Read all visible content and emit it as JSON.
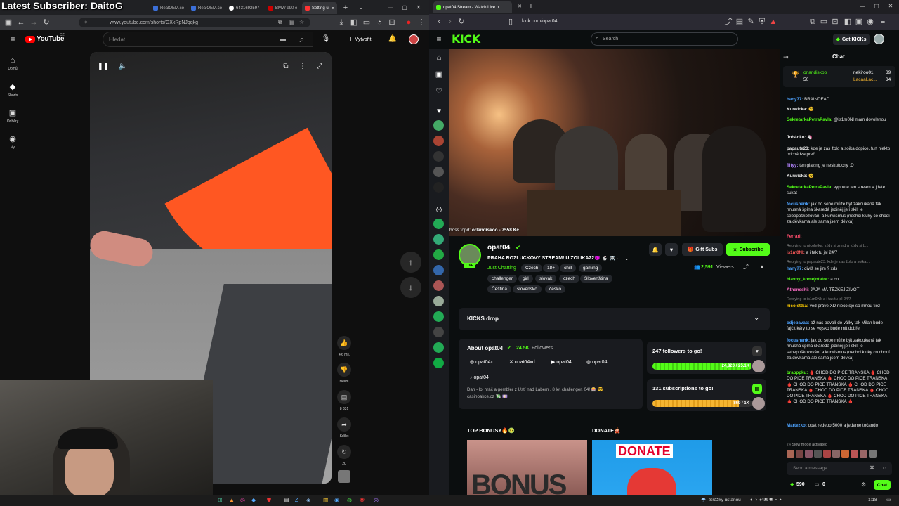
{
  "overlay": {
    "latest_subscriber": "Latest Subscriber: DaitoG"
  },
  "left_browser": {
    "tabs": [
      {
        "label": "RealOEM.co"
      },
      {
        "label": "RealOEM.co"
      },
      {
        "label": "6431692597"
      },
      {
        "label": "BMW e90 e"
      },
      {
        "label": "Setting u"
      }
    ],
    "url": "www.youtube.com/shorts/GXkRpNJqqkg"
  },
  "youtube": {
    "logo": "YouTube",
    "logo_region": "CZ",
    "search_placeholder": "Hledat",
    "create_label": "Vytvořit",
    "nav": [
      {
        "label": "Domů",
        "icon": "home-icon"
      },
      {
        "label": "Shorts",
        "icon": "shorts-icon"
      },
      {
        "label": "Odběry",
        "icon": "subscriptions-icon"
      },
      {
        "label": "Vy",
        "icon": "you-icon"
      }
    ],
    "actions": {
      "likes": "4,6 mil.",
      "dislike": "Nelíbí",
      "comments": "8 831",
      "share": "Sdílet",
      "remix": "20"
    }
  },
  "right_browser": {
    "tab_title": "opat04 Stream - Watch Live o",
    "url": "kick.com/opat04"
  },
  "kick": {
    "logo": "KICK",
    "search_placeholder": "Search",
    "get_kicks": "Get KICKs",
    "boss_topd": "boss topd:",
    "boss_topd_user": "orlandiskoo - 7558 Kč",
    "streamer": {
      "name": "opat04",
      "live": "LIVE",
      "title": "PRAHA ROZLUČKOVÝ STREAM! U ZOLIKA22😈 🐇 ☠️ ...",
      "category": "Just Chatting",
      "viewers": "2,591",
      "viewers_label": "Viewers"
    },
    "tags": [
      "Czech",
      "18+",
      "chill",
      "gaming",
      "challenger",
      "girl",
      "slovak",
      "czech",
      "Slovenština",
      "Čeština",
      "slovensko",
      "česko"
    ],
    "gift_subs": "Gift Subs",
    "subscribe": "Subscribe",
    "kicks_drop": "KICKS drop",
    "about": {
      "title": "About opat04",
      "followers": "24.5K",
      "followers_label": "Followers",
      "socials": [
        "opat04x",
        "opat04xd",
        "opat04",
        "opat04",
        "opat04"
      ],
      "bio": "Dan - lol hráč a gembler z Ústí nad Labem , 8 let challenger, 04! 🎰 😎",
      "bio2": "casinoakce.cz 💸 💷"
    },
    "goals": [
      {
        "title": "247 followers to go!",
        "value": "24,820 / 25.1K",
        "progress": 0.989
      },
      {
        "title": "131 subscriptions to go!",
        "value": "869 / 1K",
        "progress": 0.869
      }
    ],
    "panels": [
      {
        "title": "TOP BONUSY🔥🤢",
        "image_text": "BONUS"
      },
      {
        "title": "DONATE🎪",
        "image_text": "DONATE"
      }
    ]
  },
  "chat": {
    "title": "Chat",
    "top": [
      {
        "name": "orlandiskoo",
        "value": "50"
      },
      {
        "name": "nekiroo01",
        "value": "39"
      },
      {
        "name": "LacaaLac...",
        "value": "34"
      }
    ],
    "messages": [
      {
        "user": "hany77:",
        "text": "BRAINDEAD",
        "color": "#4ea3ff"
      },
      {
        "user": "Kurwicka:",
        "text": "😵",
        "color": "#fff"
      },
      {
        "user": "SekretarkaPetraPavla:",
        "text": "@is1m0Nl mam dovolenou",
        "color": "#53fc18"
      },
      {
        "user": "Joh4nko:",
        "text": "🦄",
        "color": "#fff"
      },
      {
        "user": "papaute23:",
        "text": "kde je zas žolo a soika dopice, furt niekto odchádza preč",
        "color": "#fff"
      },
      {
        "user": "filtyy:",
        "text": "ten glazing je neskutocny :D",
        "color": "#b285ff"
      },
      {
        "user": "Kurwicka:",
        "text": "😵",
        "color": "#fff"
      },
      {
        "user": "SekretarkaPetraPavla:",
        "text": "vypnete ten stream a jdete sukat",
        "color": "#53fc18"
      },
      {
        "user": "focusnenk:",
        "text": "jak do sebe může být zakoukaná tak hnusná špína škaredá jediněj její skill je sebepoškozování a kurwismus (nechci kluky co chodí za děvkama ale sama jsem děvka)",
        "color": "#4ea3ff"
      },
      {
        "user": "Ferrari:",
        "text": "",
        "color": "#ff4d6d"
      },
      {
        "user": "",
        "text": "Replying to nicoletka: vždy si zmrd a vždy si b...",
        "color": "#888"
      },
      {
        "user": "is1m0Nl:",
        "text": "a i tak tu jsl 24/7",
        "color": "#ff5a5a"
      },
      {
        "user": "",
        "text": "Replying to papaute23: kde je zas žolo a soika...",
        "color": "#888"
      },
      {
        "user": "hany77:",
        "text": "divíš se jim ? xds",
        "color": "#4ea3ff"
      },
      {
        "user": "hlavny_komejntator:",
        "text": "a co",
        "color": "#53fc18"
      },
      {
        "user": "Atheneshi:",
        "text": "JÁJA MÁ TĚŽKEJ ŽIVOT",
        "color": "#ff6ec7"
      },
      {
        "user": "",
        "text": "Replying to is1m0Nl: a i tak tu jsl 24/7",
        "color": "#888"
      },
      {
        "user": "nicolettka:",
        "text": "ved práve XD niečo sje so mnou tiež",
        "color": "#ffcc00"
      },
      {
        "user": "odjebavac:",
        "text": "až nás povolí do války tak Milan bude fajčit káry to se vojsko bude mít dobře",
        "color": "#4ea3ff"
      },
      {
        "user": "focusnenk:",
        "text": "jak do sebe může být zakoukaná tak hnusná špína škaredá jediněj její skill je sebepoškozování a kurwismus (nechci kluky co chodí za děvkama ale sama jsem děvka)",
        "color": "#4ea3ff"
      },
      {
        "user": "brapppku:",
        "text": "🩸 CHOD DO PICE TRANSKA 🩸 CHOD DO PICE TRANSKA 🩸 CHOD DO PICE TRANSKA 🩸 CHOD DO PICE TRANSKA 🩸 CHOD DO PICE TRANSKA 🩸 CHOD DO PICE TRANSKA 🩸 CHOD DO PICE TRANSKA 🩸 CHOD DO PICE TRANSKA 🩸 CHOD DO PICE TRANSKA 🩸",
        "color": "#53fc18"
      },
      {
        "user": "Martezko:",
        "text": "opat redepo 5000 a jedeme točando",
        "color": "#4ea3ff"
      }
    ],
    "slow_mode": "Slow mode activated",
    "input_placeholder": "Send a message",
    "kicks_count": "590",
    "points": "0",
    "send": "Chat"
  },
  "taskbar": {
    "weather": "Srážky ustanou",
    "time": "1:18"
  }
}
